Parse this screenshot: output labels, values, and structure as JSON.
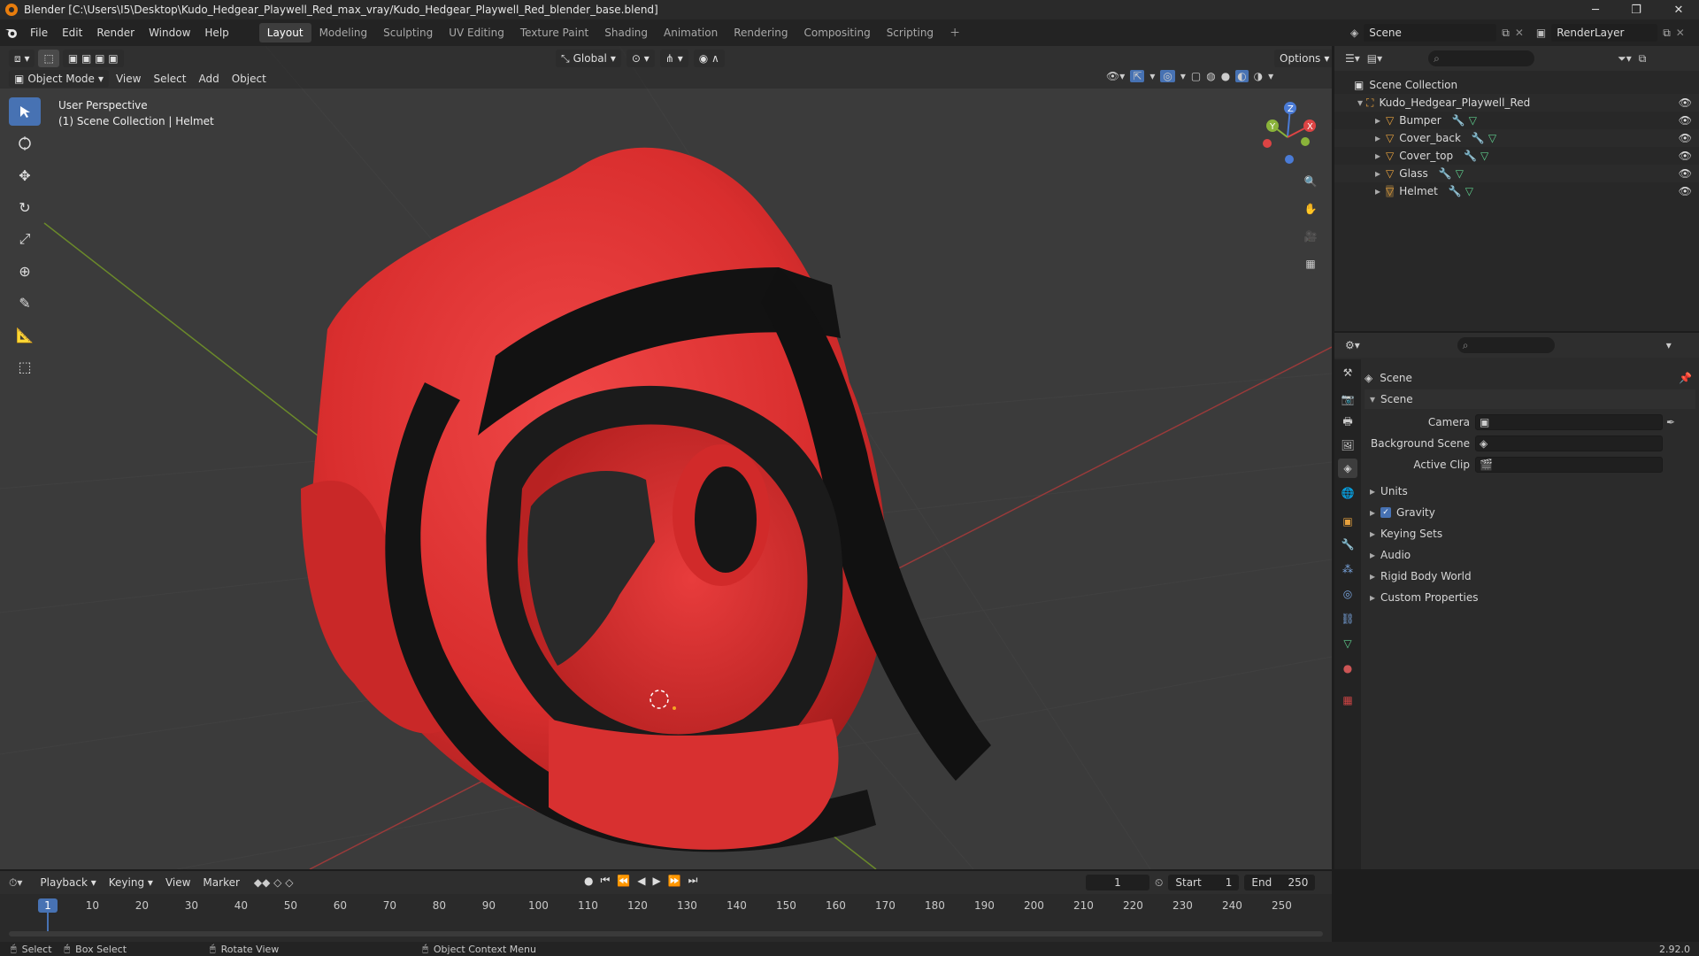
{
  "window": {
    "title": "Blender [C:\\Users\\I5\\Desktop\\Kudo_Hedgear_Playwell_Red_max_vray/Kudo_Hedgear_Playwell_Red_blender_base.blend]"
  },
  "menu": [
    "File",
    "Edit",
    "Render",
    "Window",
    "Help"
  ],
  "workspaces": [
    "Layout",
    "Modeling",
    "Sculpting",
    "UV Editing",
    "Texture Paint",
    "Shading",
    "Animation",
    "Rendering",
    "Compositing",
    "Scripting"
  ],
  "scene_selector": {
    "scene": "Scene",
    "view_layer": "RenderLayer"
  },
  "viewport": {
    "mode": "Object Mode",
    "menus": [
      "View",
      "Select",
      "Add",
      "Object"
    ],
    "orientation": "Global",
    "options": "Options",
    "overlay_title": "User Perspective",
    "overlay_sub": "(1) Scene Collection | Helmet",
    "gizmo": {
      "x": "X",
      "y": "Y",
      "z": "Z"
    }
  },
  "outliner": {
    "root": "Scene Collection",
    "collection": "Kudo_Hedgear_Playwell_Red",
    "objects": [
      "Bumper",
      "Cover_back",
      "Cover_top",
      "Glass",
      "Helmet"
    ]
  },
  "properties": {
    "header": "Scene",
    "panel": "Scene",
    "camera_label": "Camera",
    "bg_scene_label": "Background Scene",
    "active_clip_label": "Active Clip",
    "sections": [
      "Units",
      "Gravity",
      "Keying Sets",
      "Audio",
      "Rigid Body World",
      "Custom Properties"
    ]
  },
  "timeline": {
    "menus": [
      "Playback",
      "Keying",
      "View",
      "Marker"
    ],
    "current_frame": "1",
    "start_label": "Start",
    "start": "1",
    "end_label": "End",
    "end": "250",
    "ticks": [
      "1",
      "10",
      "20",
      "30",
      "40",
      "50",
      "60",
      "70",
      "80",
      "90",
      "100",
      "110",
      "120",
      "130",
      "140",
      "150",
      "160",
      "170",
      "180",
      "190",
      "200",
      "210",
      "220",
      "230",
      "240",
      "250"
    ]
  },
  "status": {
    "select": "Select",
    "box_select": "Box Select",
    "rotate": "Rotate View",
    "context": "Object Context Menu",
    "version": "2.92.0"
  }
}
